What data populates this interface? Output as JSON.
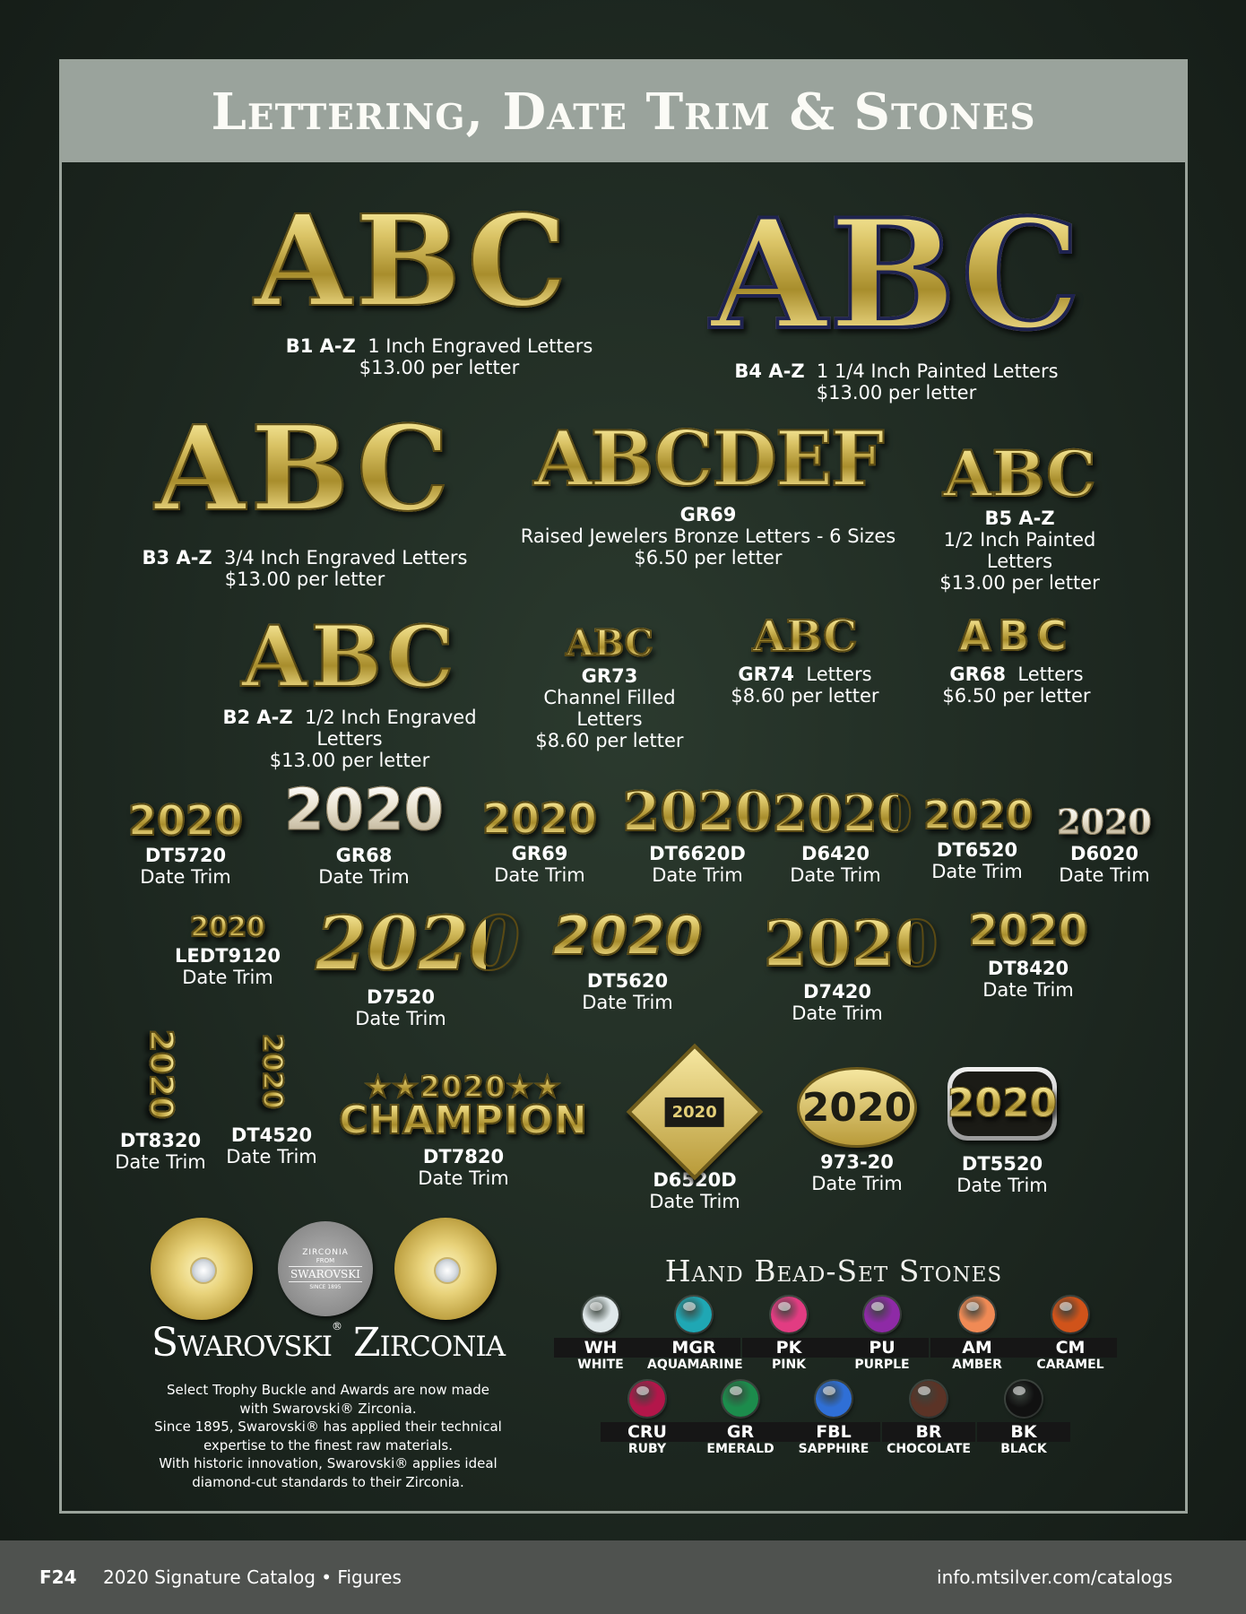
{
  "title": "Lettering, Date Trim & Stones",
  "letters": {
    "b1": {
      "art": "ABC",
      "code": "B1 A-Z",
      "desc": "1 Inch Engraved Letters",
      "price": "$13.00 per letter"
    },
    "b4": {
      "art": "ABC",
      "code": "B4 A-Z",
      "desc": "1 1/4 Inch Painted Letters",
      "price": "$13.00 per letter"
    },
    "b3": {
      "art": "ABC",
      "code": "B3 A-Z",
      "desc": "3/4 Inch Engraved Letters",
      "price": "$13.00 per letter"
    },
    "gr69": {
      "art": "ABCDEF",
      "code": "GR69",
      "desc": "Raised Jewelers Bronze Letters - 6 Sizes",
      "price": "$6.50 per letter"
    },
    "b5": {
      "art": "ABC",
      "code": "B5 A-Z",
      "desc1": "1/2 Inch Painted",
      "desc2": "Letters",
      "price": "$13.00 per letter"
    },
    "b2": {
      "art": "ABC",
      "code": "B2 A-Z",
      "desc1": "1/2 Inch Engraved",
      "desc2": "Letters",
      "price": "$13.00 per letter"
    },
    "gr73": {
      "art": "ABC",
      "code": "GR73",
      "desc1": "Channel Filled",
      "desc2": "Letters",
      "price": "$8.60 per letter"
    },
    "gr74": {
      "art": "ABC",
      "code": "GR74",
      "desc": "Letters",
      "price": "$8.60 per letter"
    },
    "gr68": {
      "art": "ABC",
      "code": "GR68",
      "desc": "Letters",
      "price": "$6.50 per letter"
    }
  },
  "date_trim_label": "Date Trim",
  "date_trims": {
    "dt5720": {
      "art": "2020",
      "code": "DT5720"
    },
    "gr68": {
      "art": "2020",
      "code": "GR68"
    },
    "gr69": {
      "art": "2020",
      "code": "GR69"
    },
    "dt6620d": {
      "art": "2020",
      "code": "DT6620D"
    },
    "d6420": {
      "art": "2020",
      "code": "D6420"
    },
    "dt6520": {
      "art": "2020",
      "code": "DT6520"
    },
    "d6020": {
      "art": "2020",
      "code": "D6020"
    },
    "ledt9120": {
      "art": "2020",
      "code": "LEDT9120"
    },
    "d7520": {
      "art": "2020",
      "code": "D7520"
    },
    "dt5620": {
      "art": "2020",
      "code": "DT5620"
    },
    "d7420": {
      "art": "2020",
      "code": "D7420"
    },
    "dt8420": {
      "art": "2020",
      "code": "DT8420"
    },
    "dt8320": {
      "art": "2020",
      "code": "DT8320"
    },
    "dt4520": {
      "art": "2020",
      "code": "DT4520"
    },
    "dt7820": {
      "art1": "2020",
      "art2": "CHAMPION",
      "code": "DT7820"
    },
    "d6520d": {
      "art": "2020",
      "code": "D6520D"
    },
    "t973": {
      "art": "2020",
      "code": "973-20"
    },
    "dt5520": {
      "art": "2020",
      "code": "DT5520"
    }
  },
  "swarovski": {
    "seal_line1": "ZIRCONIA",
    "seal_line2": "FROM",
    "seal_line3": "SWAROVSKI",
    "seal_line4": "SINCE 1895",
    "wordmark_a": "Swarovski",
    "wordmark_b": "Zirconia",
    "trademark": "®",
    "text_line1": "Select Trophy Buckle and Awards are now made",
    "text_line2": "with Swarovski® Zirconia.",
    "text_line3": "Since 1895, Swarovski® has applied their technical",
    "text_line4": "expertise to the finest raw materials.",
    "text_line5": "With historic innovation, Swarovski® applies ideal",
    "text_line6": "diamond-cut standards to their Zirconia."
  },
  "stones": {
    "title": "Hand Bead-Set Stones",
    "items": [
      {
        "code": "WH",
        "name": "WHITE",
        "color": "#dfe8ea"
      },
      {
        "code": "MGR",
        "name": "AQUAMARINE",
        "color": "#1fa7b4"
      },
      {
        "code": "PK",
        "name": "PINK",
        "color": "#e23c82"
      },
      {
        "code": "PU",
        "name": "PURPLE",
        "color": "#8e2aa6"
      },
      {
        "code": "AM",
        "name": "AMBER",
        "color": "#f08a55"
      },
      {
        "code": "CM",
        "name": "CARAMEL",
        "color": "#d0531a"
      },
      {
        "code": "CRU",
        "name": "RUBY",
        "color": "#b3164a"
      },
      {
        "code": "GR",
        "name": "EMERALD",
        "color": "#1c8c4c"
      },
      {
        "code": "FBL",
        "name": "SAPPHIRE",
        "color": "#2f6fd6"
      },
      {
        "code": "BR",
        "name": "CHOCOLATE",
        "color": "#5b3326"
      },
      {
        "code": "BK",
        "name": "BLACK",
        "color": "#111111"
      }
    ]
  },
  "footer": {
    "page": "F24",
    "catalog": "2020 Signature Catalog • Figures",
    "url": "info.mtsilver.com/catalogs"
  }
}
